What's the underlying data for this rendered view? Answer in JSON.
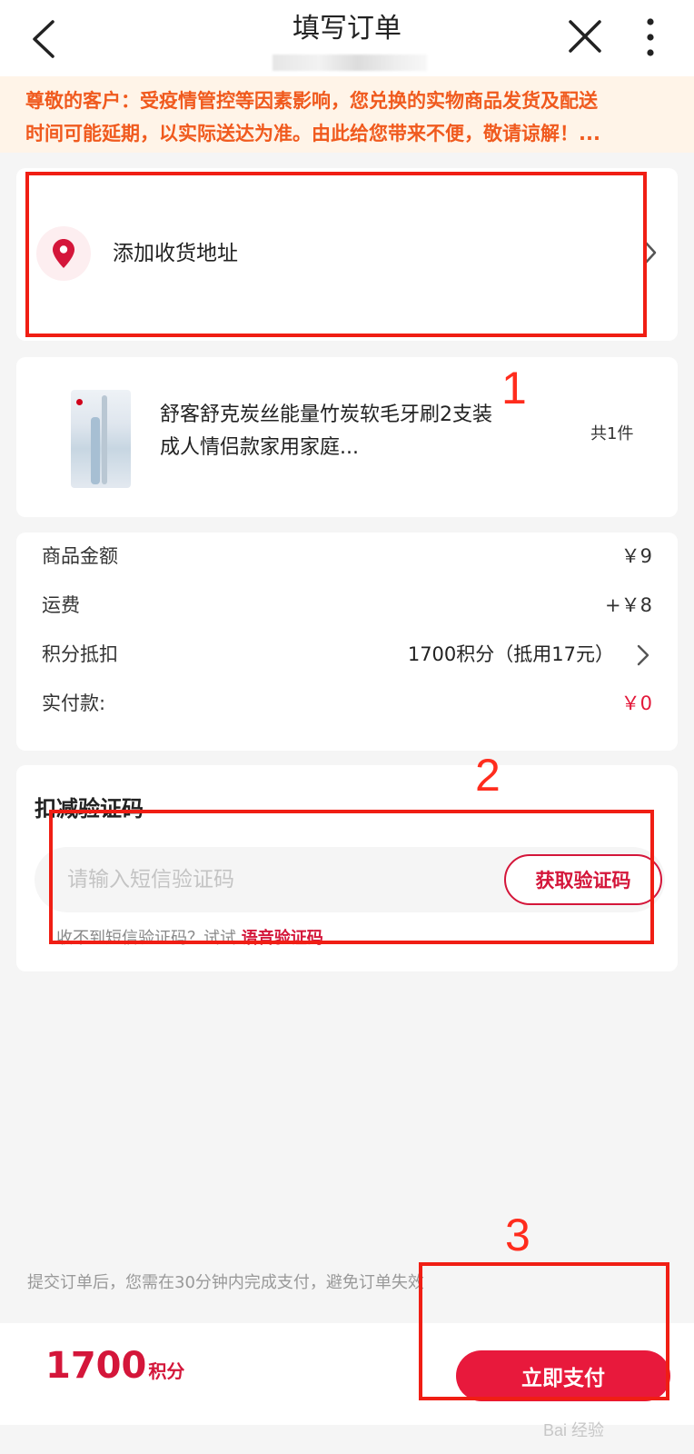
{
  "header": {
    "title": "填写订单"
  },
  "notice": {
    "line1": "尊敬的客户：受疫情管控等因素影响，您兑换的实物商品发货及配送",
    "line2": "时间可能延期，以实际送达为准。由此给您带来不便，敬请谅解！..."
  },
  "address": {
    "label": "添加收货地址"
  },
  "product": {
    "name": "舒客舒克炭丝能量竹炭软毛牙刷2支装成人情侣款家用家庭...",
    "count": "共1件"
  },
  "summary": {
    "rows": [
      {
        "label": "商品金额",
        "value": "￥9"
      },
      {
        "label": "运费",
        "value": "+￥8"
      },
      {
        "label": "积分抵扣",
        "value": "1700积分（抵用17元）"
      },
      {
        "label": "实付款:",
        "value": "￥0"
      }
    ]
  },
  "verify": {
    "title": "扣减验证码",
    "placeholder": "请输入短信验证码",
    "get_code_label": "获取验证码",
    "hint_prefix": "收不到短信验证码？试试",
    "hint_link": "语音验证码"
  },
  "footer": {
    "note": "提交订单后，您需在30分钟内完成支付，避免订单失效",
    "points_value": "1700",
    "points_unit": "积分",
    "pay_label": "立即支付"
  },
  "annotations": {
    "one": "1",
    "two": "2",
    "three": "3"
  },
  "watermark": "Bai 经验",
  "colors": {
    "accent": "#e8193c",
    "notice_text": "#f05a1e",
    "annotation": "#f01e14"
  }
}
